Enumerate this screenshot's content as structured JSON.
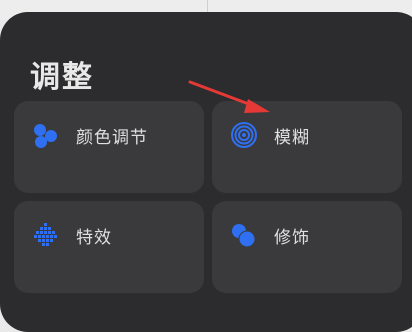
{
  "panel": {
    "title": "调整",
    "tiles": [
      {
        "label": "颜色调节",
        "icon": "color-dots-icon"
      },
      {
        "label": "模糊",
        "icon": "blur-rings-icon"
      },
      {
        "label": "特效",
        "icon": "dot-matrix-icon"
      },
      {
        "label": "修饰",
        "icon": "overlap-circles-icon"
      }
    ]
  },
  "colors": {
    "accent": "#2f6ff2",
    "panel_bg": "#2c2c2e",
    "tile_bg": "#3a3a3c",
    "annotation_arrow": "#e53935"
  }
}
